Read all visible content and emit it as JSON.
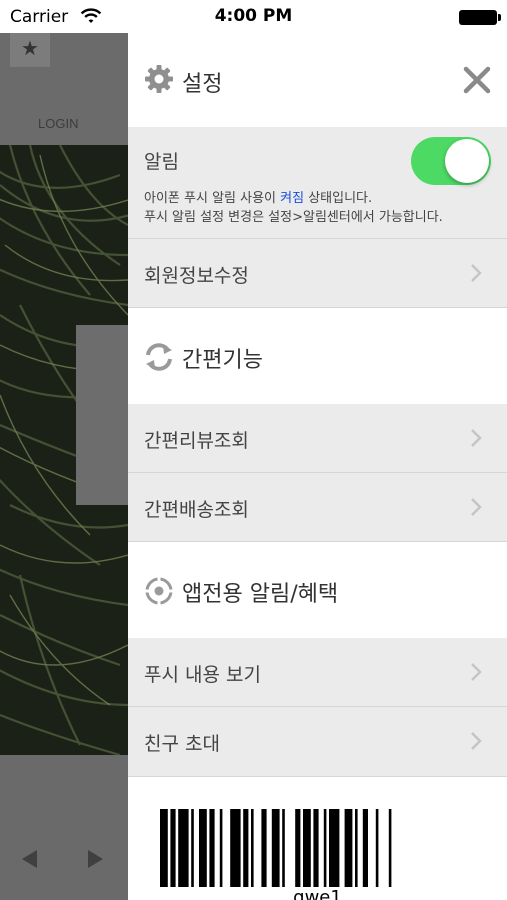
{
  "status_bar": {
    "carrier": "Carrier",
    "time": "4:00 PM"
  },
  "background_app": {
    "login_label": "LOGIN",
    "star_glyph": "★"
  },
  "panel": {
    "title": "설정",
    "alarm": {
      "label": "알림",
      "enabled": true,
      "desc_prefix": "아이폰 푸시 알림 사용이 ",
      "desc_state": "켜짐",
      "desc_suffix": " 상태입니다.",
      "desc_line2": "푸시 알림 설정 변경은 설정>알림센터에서 가능합니다."
    },
    "member_row": "회원정보수정",
    "sections": [
      {
        "title": "간편기능",
        "icon": "refresh-icon",
        "items": [
          "간편리뷰조회",
          "간편배송조회"
        ]
      },
      {
        "title": "앱전용 알림/혜택",
        "icon": "target-icon",
        "items": [
          "푸시 내용 보기",
          "친구 초대"
        ]
      }
    ],
    "barcode_caption": "qwe1"
  },
  "colors": {
    "toggle_on": "#4cd964",
    "row_bg": "#ebebeb",
    "state_text": "#1a4dd8"
  }
}
